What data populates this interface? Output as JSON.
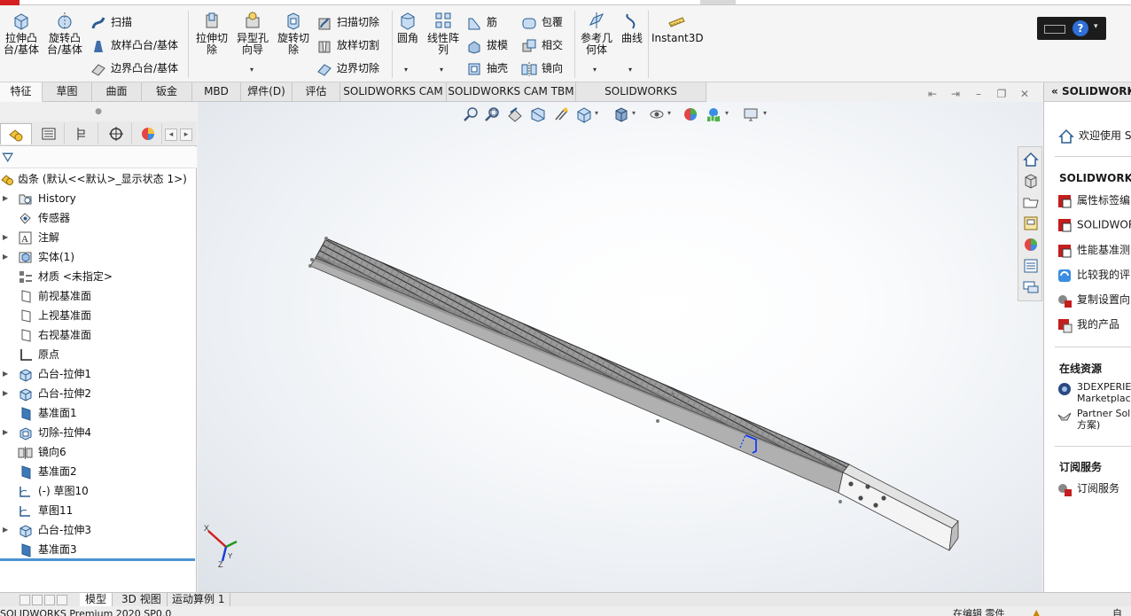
{
  "ribbon": {
    "extrude_boss": "拉伸凸\n台/基体",
    "revolve_boss": "旋转凸\n台/基体",
    "sweep": "扫描",
    "loft": "放样凸台/基体",
    "boundary_boss": "边界凸台/基体",
    "extrude_cut": "拉伸切\n除",
    "hole_wizard": "异型孔\n向导",
    "revolve_cut": "旋转切\n除",
    "swept_cut": "扫描切除",
    "lofted_cut": "放样切割",
    "boundary_cut": "边界切除",
    "fillet": "圆角",
    "linear_pattern": "线性阵\n列",
    "rib": "筋",
    "draft": "拔模",
    "shell": "抽壳",
    "wrap": "包覆",
    "intersect": "相交",
    "mirror": "镜向",
    "ref_geometry": "参考几\n何体",
    "curves": "曲线",
    "instant3d": "Instant3D"
  },
  "command_tabs": [
    "特征",
    "草图",
    "曲面",
    "钣金",
    "MBD",
    "焊件(D)",
    "评估",
    "SOLIDWORKS CAM",
    "SOLIDWORKS CAM TBM",
    "SOLIDWORKS Inspection"
  ],
  "feature_tree": {
    "root": "齿条  (默认<<默认>_显示状态 1>)",
    "items": [
      {
        "label": "History",
        "icon": "history-folder-icon",
        "expand": true
      },
      {
        "label": "传感器",
        "icon": "sensor-icon",
        "expand": false
      },
      {
        "label": "注解",
        "icon": "annotation-icon",
        "expand": true
      },
      {
        "label": "实体(1)",
        "icon": "solid-bodies-icon",
        "expand": true
      },
      {
        "label": "材质 <未指定>",
        "icon": "material-icon",
        "expand": false
      },
      {
        "label": "前视基准面",
        "icon": "plane-icon",
        "expand": false
      },
      {
        "label": "上视基准面",
        "icon": "plane-icon",
        "expand": false
      },
      {
        "label": "右视基准面",
        "icon": "plane-icon",
        "expand": false
      },
      {
        "label": "原点",
        "icon": "origin-icon",
        "expand": false
      },
      {
        "label": "凸台-拉伸1",
        "icon": "extrude-feature-icon",
        "expand": true
      },
      {
        "label": "凸台-拉伸2",
        "icon": "extrude-feature-icon",
        "expand": true
      },
      {
        "label": "基准面1",
        "icon": "ref-plane-icon",
        "expand": false
      },
      {
        "label": "切除-拉伸4",
        "icon": "cut-feature-icon",
        "expand": true
      },
      {
        "label": "镜向6",
        "icon": "mirror-feature-icon",
        "expand": false
      },
      {
        "label": "基准面2",
        "icon": "ref-plane-icon",
        "expand": false
      },
      {
        "label": "(-) 草图10",
        "icon": "sketch-icon",
        "expand": false
      },
      {
        "label": "草图11",
        "icon": "sketch-icon",
        "expand": false
      },
      {
        "label": "凸台-拉伸3",
        "icon": "extrude-feature-icon",
        "expand": true
      },
      {
        "label": "基准面3",
        "icon": "ref-plane-icon",
        "expand": false
      }
    ]
  },
  "right_panel": {
    "header": "SOLIDWORKS",
    "welcome": "欢迎使用  S",
    "tools_section": "SOLIDWORKS 工",
    "tools": [
      "属性标签编",
      "SOLIDWOR",
      "性能基准测",
      "比较我的评",
      "复制设置向",
      "我的产品"
    ],
    "online_section": "在线资源",
    "online": [
      "3DEXPERIEN\nMarketplac",
      "Partner Sol\n方案)"
    ],
    "subscription_section": "订阅服务",
    "subscription": [
      "订阅服务"
    ]
  },
  "bottom_tabs": [
    "模型",
    "3D 视图",
    "运动算例 1"
  ],
  "status": {
    "left": "SOLIDWORKS Premium 2020 SP0.0",
    "mid": "在编辑 零件",
    "right": "自定"
  },
  "triad": {
    "x": "X",
    "y": "Y",
    "z": "Z"
  },
  "colors": {
    "accent_blue": "#2f6fd6",
    "selection_blue": "#0033ff",
    "tree_bottom_bar": "#4a92d1"
  }
}
